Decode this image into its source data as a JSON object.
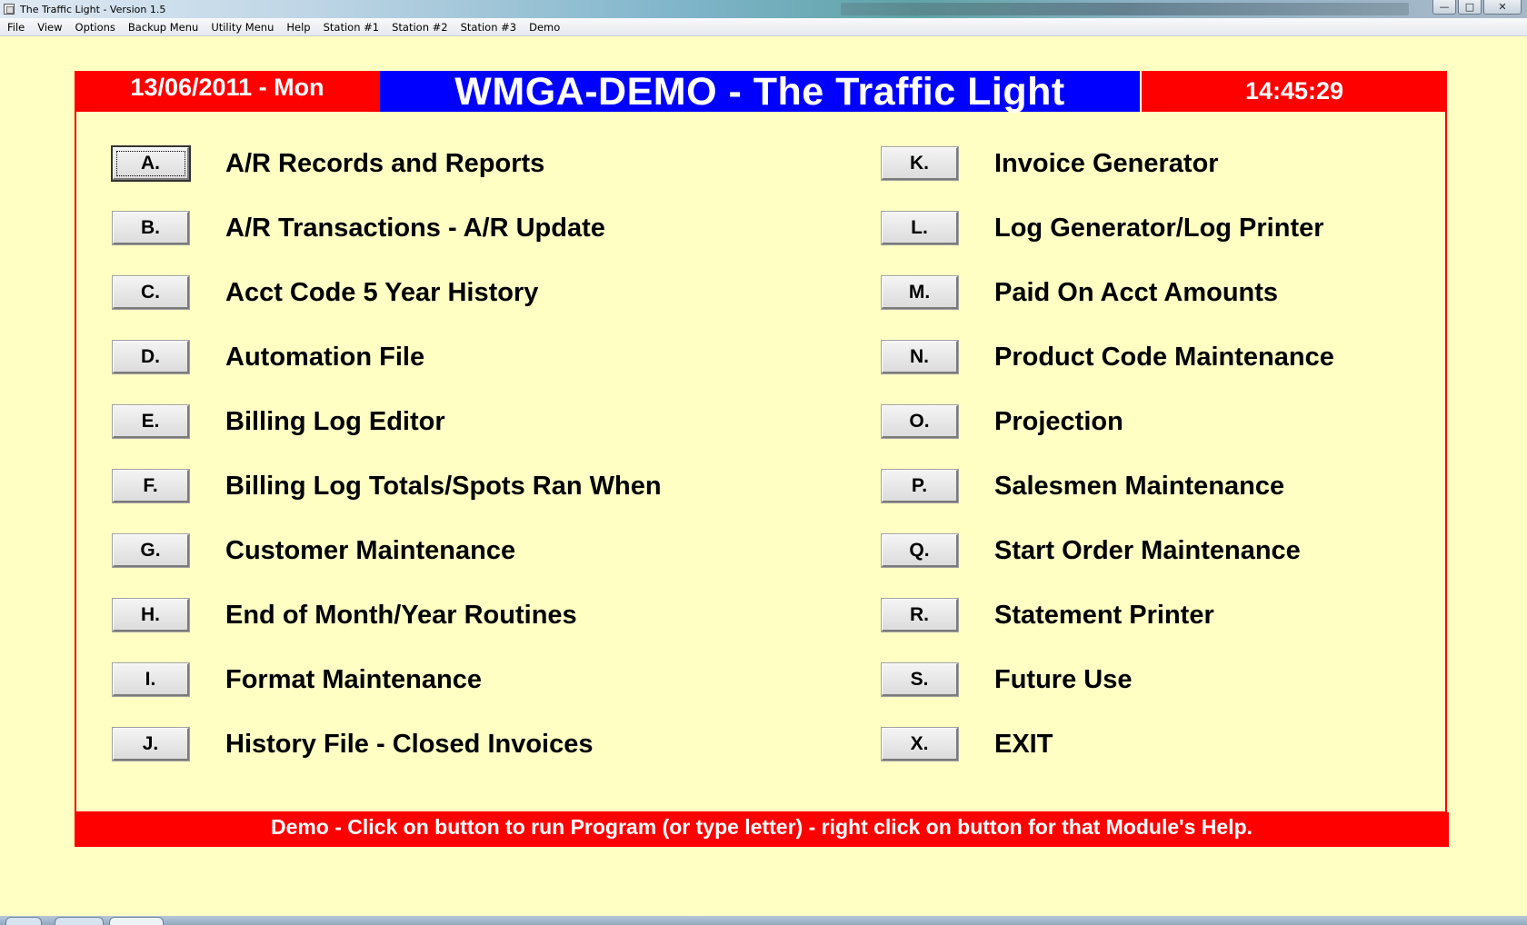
{
  "window": {
    "title": "The Traffic Light - Version 1.5",
    "controls": {
      "minimize": "—",
      "maximize": "□",
      "close": "✕"
    }
  },
  "menubar": {
    "items": [
      "File",
      "View",
      "Options",
      "Backup Menu",
      "Utility Menu",
      "Help",
      "Station #1",
      "Station #2",
      "Station #3",
      "Demo"
    ]
  },
  "header": {
    "date": "13/06/2011 - Mon",
    "title": "WMGA-DEMO - The Traffic Light",
    "time": "14:45:29"
  },
  "menu": {
    "left": [
      {
        "key": "A.",
        "label": "A/R Records and Reports"
      },
      {
        "key": "B.",
        "label": "A/R Transactions - A/R Update"
      },
      {
        "key": "C.",
        "label": "Acct Code 5 Year History"
      },
      {
        "key": "D.",
        "label": "Automation File"
      },
      {
        "key": "E.",
        "label": "Billing Log Editor"
      },
      {
        "key": "F.",
        "label": "Billing Log Totals/Spots Ran When"
      },
      {
        "key": "G.",
        "label": "Customer Maintenance"
      },
      {
        "key": "H.",
        "label": "End of Month/Year Routines"
      },
      {
        "key": "I.",
        "label": "Format Maintenance"
      },
      {
        "key": "J.",
        "label": "History File - Closed Invoices"
      }
    ],
    "right": [
      {
        "key": "K.",
        "label": "Invoice Generator"
      },
      {
        "key": "L.",
        "label": "Log Generator/Log Printer"
      },
      {
        "key": "M.",
        "label": "Paid On Acct Amounts"
      },
      {
        "key": "N.",
        "label": "Product Code Maintenance"
      },
      {
        "key": "O.",
        "label": "Projection"
      },
      {
        "key": "P.",
        "label": "Salesmen Maintenance"
      },
      {
        "key": "Q.",
        "label": "Start Order Maintenance"
      },
      {
        "key": "R.",
        "label": "Statement Printer"
      },
      {
        "key": "S.",
        "label": "Future Use"
      },
      {
        "key": "X.",
        "label": "EXIT"
      }
    ]
  },
  "footer": {
    "text": "Demo - Click on button to run Program (or type letter) - right click on button for that Module's Help."
  },
  "colors": {
    "background": "#FFFFC4",
    "red": "#FF0000",
    "blue": "#0000FF"
  }
}
